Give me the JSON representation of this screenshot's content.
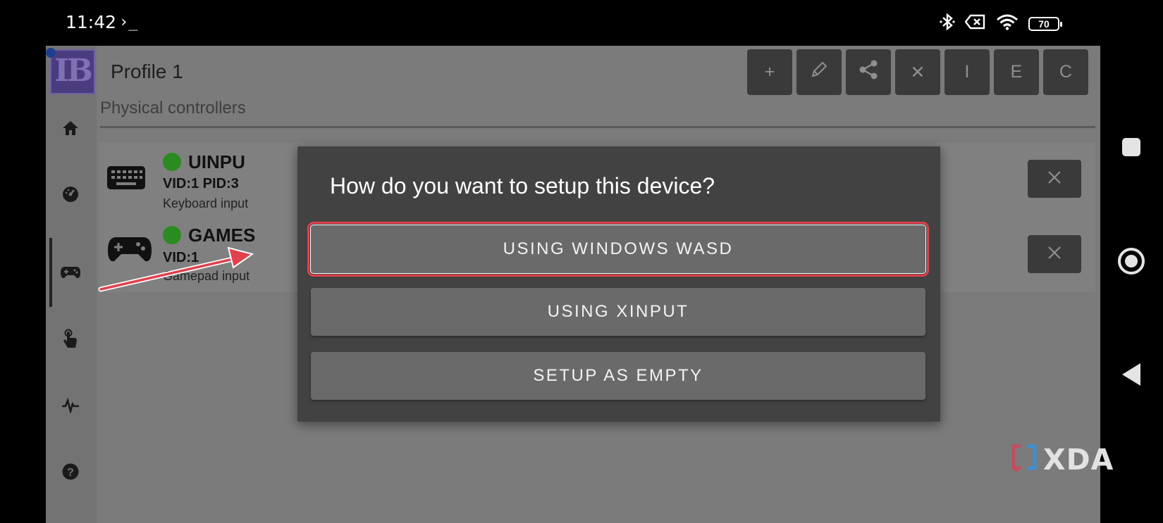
{
  "status_bar": {
    "time": "11:42",
    "terminal_glyph": "›_",
    "battery": "70"
  },
  "header": {
    "title": "Profile 1",
    "logo_text": "IB",
    "toolbar": [
      {
        "label": "+",
        "icon": "plus-icon"
      },
      {
        "label": "",
        "icon": "pencil-icon"
      },
      {
        "label": "",
        "icon": "share-icon"
      },
      {
        "label": "✕",
        "icon": "close-icon"
      },
      {
        "label": "I",
        "icon": "import-letter"
      },
      {
        "label": "E",
        "icon": "export-letter"
      },
      {
        "label": "C",
        "icon": "copy-letter"
      }
    ]
  },
  "sidebar": {
    "items": [
      {
        "icon": "home-icon"
      },
      {
        "icon": "gauge-icon"
      },
      {
        "icon": "gamepad-icon",
        "active": true
      },
      {
        "icon": "touch-icon"
      },
      {
        "icon": "activity-icon"
      },
      {
        "icon": "help-icon"
      }
    ]
  },
  "main": {
    "section_title": "Physical controllers",
    "devices": [
      {
        "name": "UINPU",
        "ids": "VID:1 PID:3",
        "description": "Keyboard input",
        "icon": "keyboard-icon"
      },
      {
        "name": "GAMES",
        "ids": "VID:1",
        "description": "Gamepad input",
        "icon": "gamepad-icon"
      }
    ]
  },
  "dialog": {
    "title": "How do you want to setup this device?",
    "options": [
      {
        "label": "USING WINDOWS WASD",
        "highlighted": true
      },
      {
        "label": "USING XINPUT"
      },
      {
        "label": "SETUP AS EMPTY"
      }
    ]
  },
  "watermark": {
    "text": "XDA"
  },
  "colors": {
    "dialog_bg": "#424242",
    "button_bg": "#6a6a6a",
    "highlight": "#e0414b",
    "status_green": "#2a8b20"
  }
}
